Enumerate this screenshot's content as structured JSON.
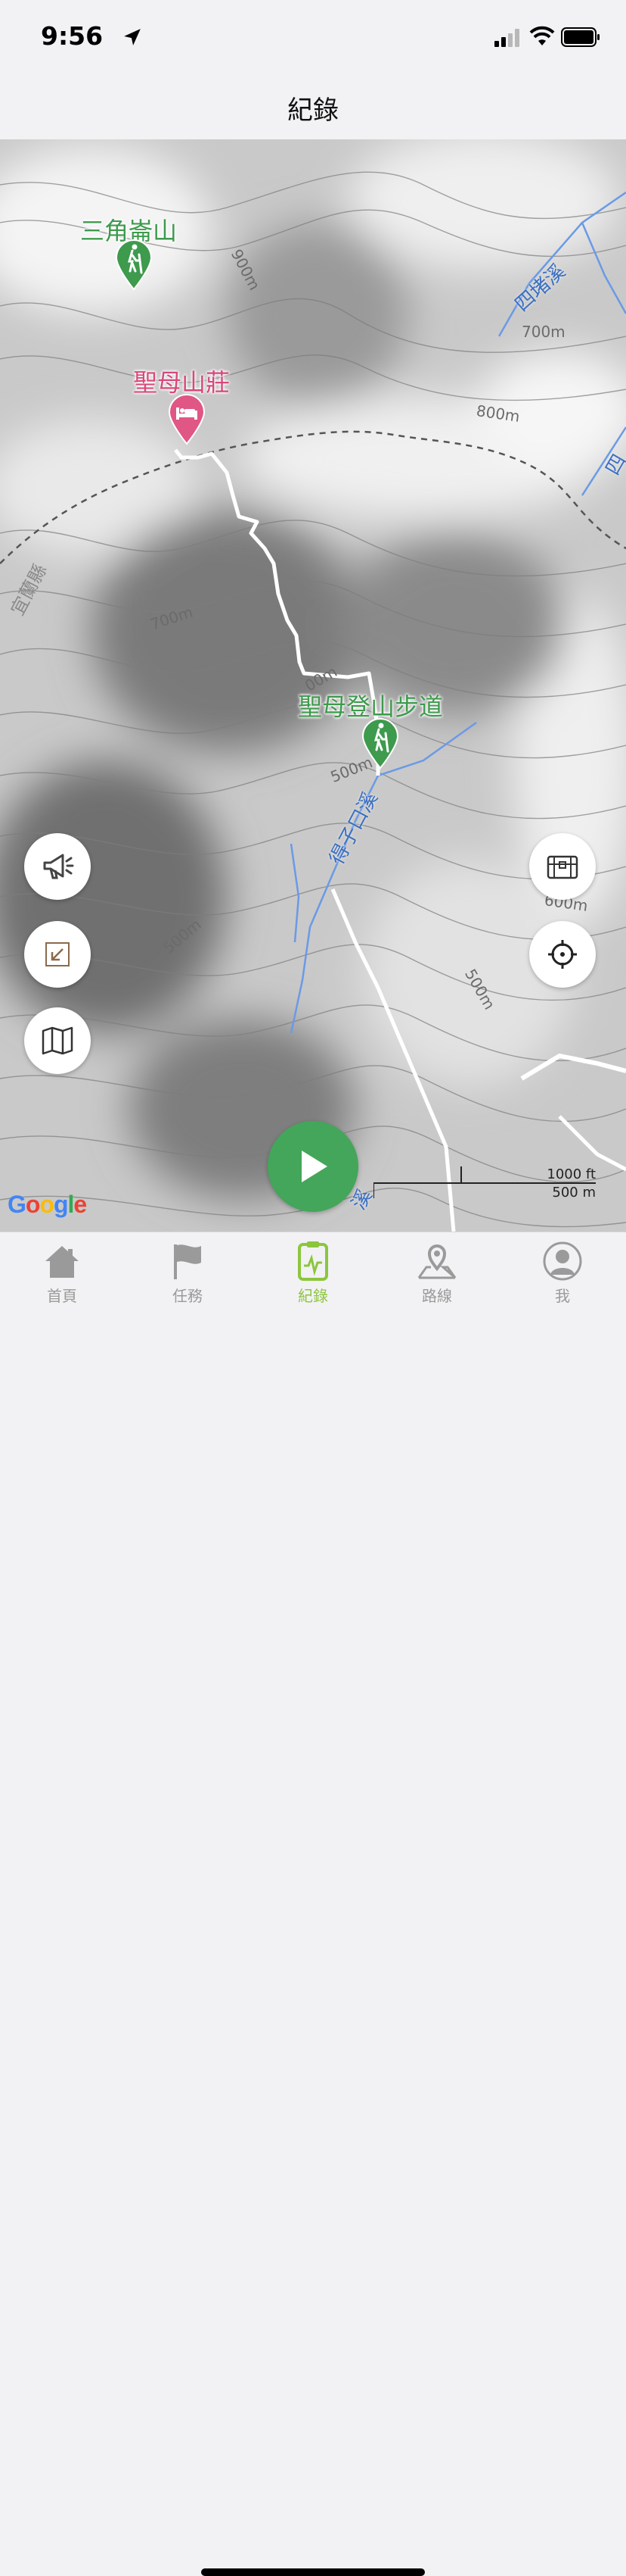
{
  "status": {
    "time": "9:56"
  },
  "header": {
    "title": "紀錄"
  },
  "map": {
    "places": {
      "peak1": "三角崙山",
      "lodge": "聖母山莊",
      "trailhead": "聖母登山步道"
    },
    "streams": {
      "s1": "四堵溪",
      "s2": "得子口溪",
      "s3": "四",
      "s4": "溪"
    },
    "region": "宜蘭縣",
    "contours": {
      "c1": "900m",
      "c2": "700m",
      "c3": "800m",
      "c4": "700m",
      "c5": "500m",
      "c6": "600m",
      "c7": "500m",
      "c8": "500m",
      "c9": "00m"
    },
    "scale": {
      "imperial": "1000 ft",
      "metric": "500 m"
    },
    "attribution": "Google"
  },
  "tabs": [
    {
      "label": "首頁",
      "icon": "home-icon"
    },
    {
      "label": "任務",
      "icon": "flag-icon"
    },
    {
      "label": "紀錄",
      "icon": "record-icon",
      "active": true
    },
    {
      "label": "路線",
      "icon": "route-icon"
    },
    {
      "label": "我",
      "icon": "profile-icon"
    }
  ],
  "colors": {
    "accent": "#43a65a",
    "active_tab": "#8cc63e",
    "poi_green": "#3e9a4d",
    "poi_pink": "#d8487a",
    "water": "#5b8fe0"
  }
}
